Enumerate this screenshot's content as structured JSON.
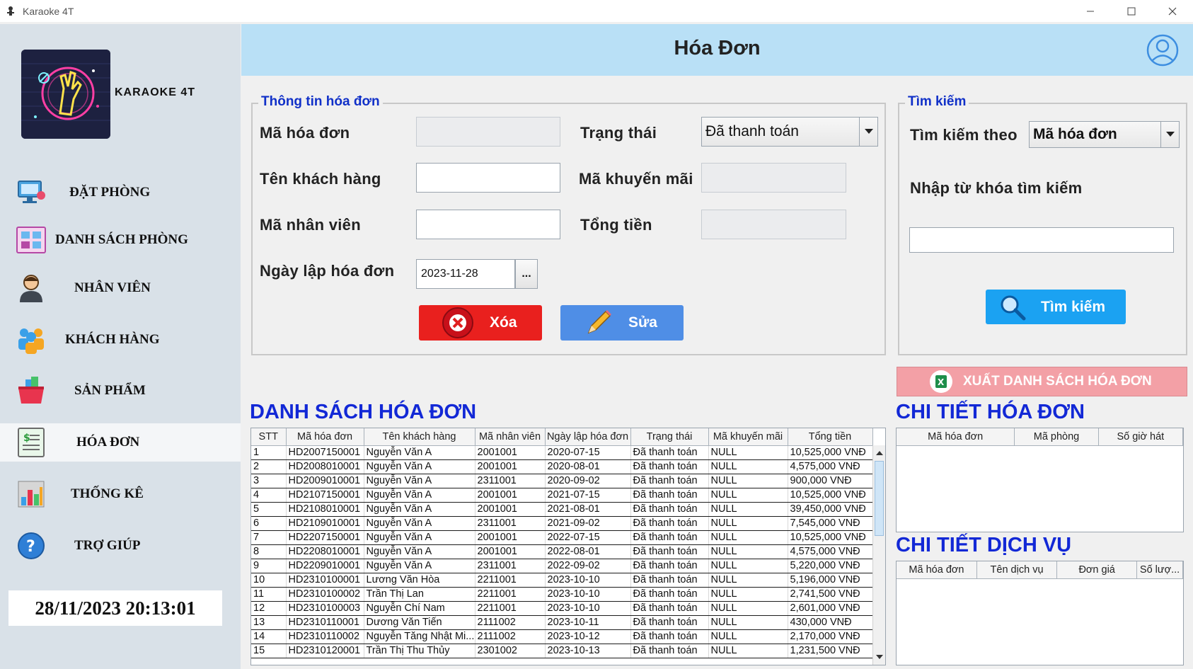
{
  "window": {
    "title": "Karaoke 4T"
  },
  "sidebar": {
    "brand": "KARAOKE 4T",
    "items": [
      {
        "label": "ĐẶT PHÒNG",
        "icon": "booking-icon"
      },
      {
        "label": "DANH SÁCH PHÒNG",
        "icon": "room-list-icon"
      },
      {
        "label": "NHÂN VIÊN",
        "icon": "employee-icon"
      },
      {
        "label": "KHÁCH HÀNG",
        "icon": "customers-icon"
      },
      {
        "label": "SẢN PHẨM",
        "icon": "products-icon"
      },
      {
        "label": "HÓA ĐƠN",
        "icon": "invoice-icon",
        "active": true
      },
      {
        "label": "THỐNG KÊ",
        "icon": "chart-icon"
      },
      {
        "label": "TRỢ GIÚP",
        "icon": "help-icon"
      }
    ],
    "clock": "28/11/2023 20:13:01"
  },
  "header": {
    "title": "Hóa Đơn"
  },
  "invoice_info": {
    "title": "Thông tin hóa đơn",
    "invoice_id_label": "Mã hóa đơn",
    "invoice_id_value": "",
    "customer_name_label": "Tên khách hàng",
    "customer_name_value": "",
    "employee_id_label": "Mã nhân viên",
    "employee_id_value": "",
    "date_label": "Ngày lập hóa đơn",
    "date_value": "2023-11-28",
    "date_picker_label": "...",
    "status_label": "Trạng thái",
    "status_value": "Đã thanh toán",
    "promo_label": "Mã khuyến mãi",
    "promo_value": "",
    "total_label": "Tổng tiền",
    "total_value": "",
    "delete_label": "Xóa",
    "edit_label": "Sửa"
  },
  "search": {
    "title": "Tìm kiếm",
    "by_label": "Tìm kiếm theo",
    "by_value": "Mã hóa đơn",
    "keyword_label": "Nhập từ khóa tìm kiếm",
    "keyword_value": "",
    "button_label": "Tìm kiếm"
  },
  "export_label": "XUẤT DANH SÁCH HÓA ĐƠN",
  "invoice_list": {
    "title": "DANH SÁCH HÓA ĐƠN",
    "columns": [
      "STT",
      "Mã hóa đơn",
      "Tên khách hàng",
      "Mã nhân viên",
      "Ngày lập hóa đơn",
      "Trạng thái",
      "Mã khuyến mãi",
      "Tổng tiền"
    ],
    "rows": [
      [
        "1",
        "HD2007150001",
        "Nguyễn Văn A",
        "2001001",
        "2020-07-15",
        "Đã thanh toán",
        "NULL",
        "10,525,000 VNĐ"
      ],
      [
        "2",
        "HD2008010001",
        "Nguyễn Văn A",
        "2001001",
        "2020-08-01",
        "Đã thanh toán",
        "NULL",
        "4,575,000 VNĐ"
      ],
      [
        "3",
        "HD2009010001",
        "Nguyễn Văn A",
        "2311001",
        "2020-09-02",
        "Đã thanh toán",
        "NULL",
        "900,000 VNĐ"
      ],
      [
        "4",
        "HD2107150001",
        "Nguyễn Văn A",
        "2001001",
        "2021-07-15",
        "Đã thanh toán",
        "NULL",
        "10,525,000 VNĐ"
      ],
      [
        "5",
        "HD2108010001",
        "Nguyễn Văn A",
        "2001001",
        "2021-08-01",
        "Đã thanh toán",
        "NULL",
        "39,450,000 VNĐ"
      ],
      [
        "6",
        "HD2109010001",
        "Nguyễn Văn A",
        "2311001",
        "2021-09-02",
        "Đã thanh toán",
        "NULL",
        "7,545,000 VNĐ"
      ],
      [
        "7",
        "HD2207150001",
        "Nguyễn Văn A",
        "2001001",
        "2022-07-15",
        "Đã thanh toán",
        "NULL",
        "10,525,000 VNĐ"
      ],
      [
        "8",
        "HD2208010001",
        "Nguyễn Văn A",
        "2001001",
        "2022-08-01",
        "Đã thanh toán",
        "NULL",
        "4,575,000 VNĐ"
      ],
      [
        "9",
        "HD2209010001",
        "Nguyễn Văn A",
        "2311001",
        "2022-09-02",
        "Đã thanh toán",
        "NULL",
        "5,220,000 VNĐ"
      ],
      [
        "10",
        "HD2310100001",
        "Lương Văn Hòa",
        "2211001",
        "2023-10-10",
        "Đã thanh toán",
        "NULL",
        "5,196,000 VNĐ"
      ],
      [
        "11",
        "HD2310100002",
        "Trần Thị Lan",
        "2211001",
        "2023-10-10",
        "Đã thanh toán",
        "NULL",
        "2,741,500 VNĐ"
      ],
      [
        "12",
        "HD2310100003",
        "Nguyễn Chí Nam",
        "2211001",
        "2023-10-10",
        "Đã thanh toán",
        "NULL",
        "2,601,000 VNĐ"
      ],
      [
        "13",
        "HD2310110001",
        "Dương Văn Tiến",
        "2111002",
        "2023-10-11",
        "Đã thanh toán",
        "NULL",
        "430,000 VNĐ"
      ],
      [
        "14",
        "HD2310110002",
        "Nguyễn Tăng Nhật Mi...",
        "2111002",
        "2023-10-12",
        "Đã thanh toán",
        "NULL",
        "2,170,000 VNĐ"
      ],
      [
        "15",
        "HD2310120001",
        "Trần Thị Thu Thủy",
        "2301002",
        "2023-10-13",
        "Đã thanh toán",
        "NULL",
        "1,231,500 VNĐ"
      ]
    ]
  },
  "invoice_detail": {
    "title": "CHI TIẾT HÓA ĐƠN",
    "columns": [
      "Mã hóa đơn",
      "Mã phòng",
      "Số giờ hát"
    ]
  },
  "service_detail": {
    "title": "CHI TIẾT DỊCH VỤ",
    "columns": [
      "Mã hóa đơn",
      "Tên dịch vụ",
      "Đơn giá",
      "Số lượ..."
    ]
  },
  "colors": {
    "accent": "#1228d6",
    "header_bg": "#b9e0f6",
    "sidebar_bg": "#d9e1e8",
    "delete": "#e9201e",
    "edit": "#4f8ee6",
    "search": "#1ba2f2",
    "export": "#f3a0a6"
  }
}
